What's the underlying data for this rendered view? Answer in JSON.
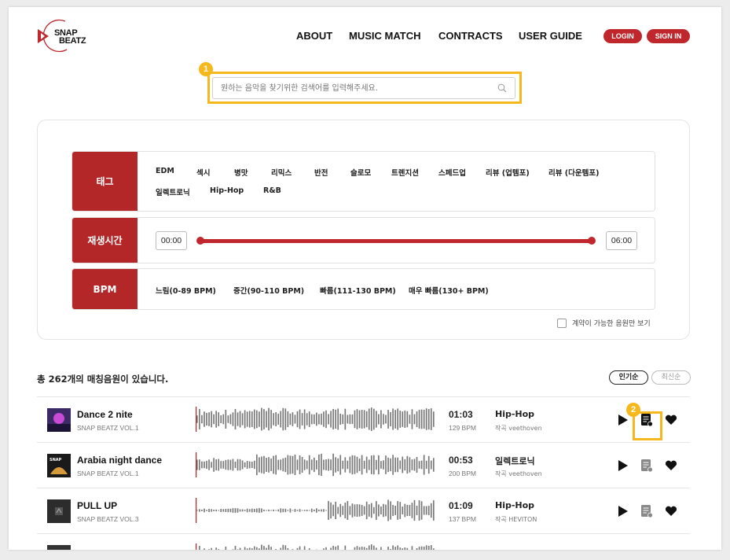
{
  "header": {
    "logo_line1": "SNAP",
    "logo_line2": "BEATZ",
    "nav": [
      "ABOUT",
      "MUSIC MATCH",
      "CONTRACTS",
      "USER GUIDE"
    ],
    "login_label": "LOGIN",
    "signin_label": "SIGN IN",
    "accent_color": "#c0272d"
  },
  "search": {
    "placeholder": "원하는 음악을 찾기위한 검색어를 입력해주세요.",
    "badge": "1"
  },
  "filters": {
    "tag_label": "태그",
    "tags": [
      "EDM",
      "섹시",
      "병맛",
      "리믹스",
      "반전",
      "슬로모",
      "트렌지션",
      "스페드업",
      "리뷰 (업템포)",
      "리뷰 (다운템포)",
      "일렉트로닉",
      "Hip-Hop",
      "R&B"
    ],
    "duration_label": "재생시간",
    "duration_min": "00:00",
    "duration_max": "06:00",
    "bpm_label": "BPM",
    "bpm_options": [
      "느림(0-89 BPM)",
      "중간(90-110 BPM)",
      "빠름(111-130 BPM)",
      "매우 빠름(130+ BPM)"
    ],
    "contract_only_label": "계약이 가능한 음원만 보기",
    "contract_only_checked": false
  },
  "results": {
    "total_text": "총 262개의 매칭음원이 있습니다.",
    "sort_popular": "인기순",
    "sort_latest": "최신순",
    "badge": "2",
    "tracks": [
      {
        "title": "Dance 2 nite",
        "album": "SNAP BEATZ VOL.1",
        "duration": "01:03",
        "bpm": "129 BPM",
        "genre": "Hip-Hop",
        "composer": "작곡 veethoven",
        "icon": "album-cover"
      },
      {
        "title": "Arabia night dance",
        "album": "SNAP BEATZ VOL.1",
        "duration": "00:53",
        "bpm": "200 BPM",
        "genre": "일렉트로닉",
        "composer": "작곡 veethoven",
        "icon": "album-cover"
      },
      {
        "title": "PULL UP",
        "album": "SNAP BEATZ VOL.3",
        "duration": "01:09",
        "bpm": "137 BPM",
        "genre": "Hip-Hop",
        "composer": "작곡 HEVITON",
        "icon": "album-cover"
      }
    ]
  }
}
